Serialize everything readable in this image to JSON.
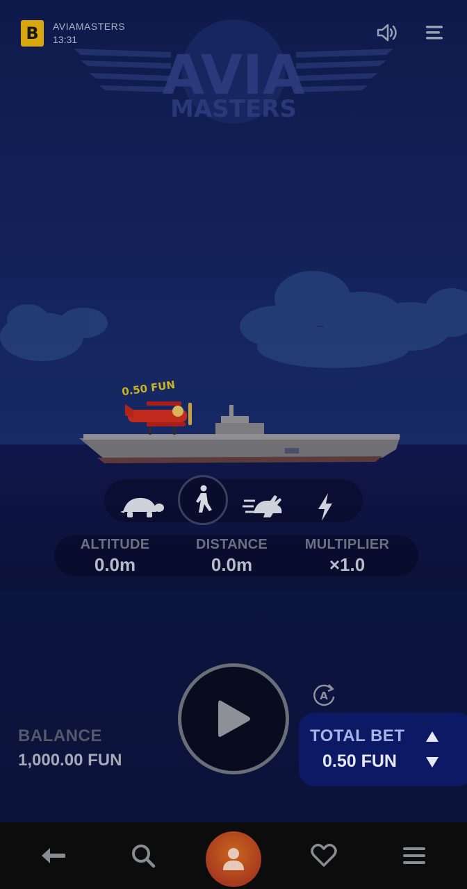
{
  "app": {
    "badge_letter": "B",
    "title": "AVIAMASTERS",
    "time": "13:31"
  },
  "logo": {
    "line1": "AVIA",
    "line2": "MASTERS"
  },
  "game": {
    "plane_bet_label": "0.50 FUN",
    "speed_options": [
      {
        "icon": "turtle-icon",
        "selected": false
      },
      {
        "icon": "walking-person-icon",
        "selected": true
      },
      {
        "icon": "rabbit-icon",
        "selected": false
      },
      {
        "icon": "lightning-icon",
        "selected": false
      }
    ]
  },
  "stats": {
    "altitude_label": "ALTITUDE",
    "altitude_value": "0.0m",
    "distance_label": "DISTANCE",
    "distance_value": "0.0m",
    "multiplier_label": "MULTIPLIER",
    "multiplier_value": "×1.0"
  },
  "controls": {
    "balance_label": "BALANCE",
    "balance_value": "1,000.00 FUN",
    "total_bet_label": "TOTAL BET",
    "total_bet_value": "0.50 FUN",
    "play_icon": "play-icon",
    "autoplay_icon": "autoplay-icon"
  },
  "bottom_nav": {
    "items": [
      "back-arrow-icon",
      "search-icon",
      "profile-icon",
      "heart-icon",
      "hamburger-menu-icon"
    ]
  },
  "colors": {
    "badge": "#d8a70f",
    "bet_panel": "#0c1a66",
    "profile_button": "#b94a1e",
    "sky": "#172a66"
  }
}
